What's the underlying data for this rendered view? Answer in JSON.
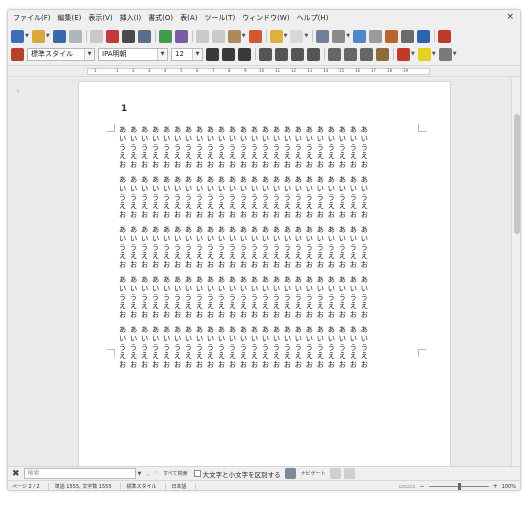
{
  "menubar": {
    "items": [
      "ファイル(F)",
      "編集(E)",
      "表示(V)",
      "挿入(I)",
      "書式(O)",
      "表(A)",
      "ツール(T)",
      "ウィンドウ(W)",
      "ヘルプ(H)"
    ],
    "close_glyph": "×"
  },
  "toolbar": {
    "paragraph_style": "標準スタイル",
    "font_name": "IPA明朝",
    "font_size": "12"
  },
  "ruler": {
    "labels": [
      "1",
      "1",
      "2",
      "3",
      "4",
      "5",
      "6",
      "7",
      "8",
      "9",
      "10",
      "11",
      "12",
      "13",
      "14",
      "15",
      "16",
      "17",
      "18",
      "19"
    ]
  },
  "document": {
    "page_number_text": "1",
    "blocks": [
      [
        "あああああああああああああああああああああああ",
        "いいいいいいいいいいいいいいいいいいいいいいい",
        "ううううううううううううううううううううううう",
        "えええええええええええええええええええええええ",
        "おおおおおおおおおおおおおおおおおおおおおおお"
      ],
      [
        "あああああああああああああああああああああああ",
        "いいいいいいいいいいいいいいいいいいいいいいい",
        "ううううううううううううううううううううううう",
        "えええええええええええええええええええええええ",
        "おおおおおおおおおおおおおおおおおおおおおおお"
      ],
      [
        "あああああああああああああああああああああああ",
        "いいいいいいいいいいいいいいいいいいいいいいい",
        "ううううううううううううううううううううううう",
        "えええええええええええええええええええええええ",
        "おおおおおおおおおおおおおおおおおおおおおおお"
      ],
      [
        "あああああああああああああああああああああああ",
        "いいいいいいいいいいいいいいいいいいいいいいい",
        "ううううううううううううううううううううううう",
        "えええええええええええええええええええええええ",
        "おおおおおおおおおおおおおおおおおおおおおおお"
      ],
      [
        "あああああああああああああああああああああああ",
        "いいいいいいいいいいいいいいいいいいいいいいい",
        "ううううううううううううううううううううううう",
        "えええええええええええええええええええええええ",
        "おおおおおおおおおおおおおおおおおおおおおおお"
      ]
    ]
  },
  "findbar": {
    "search_placeholder": "検索",
    "find_all_label": "すべて検索",
    "match_case_label": "大文字と小文字を区別する",
    "navigation_label": "ナビゲート"
  },
  "statusbar": {
    "page": "ページ 2 / 2",
    "word_count": "単語 1555, 文字数 1555",
    "page_style": "標準スタイル",
    "language": "日本語",
    "zoom": "100%"
  },
  "colors": {
    "page_bg": "#ffffff",
    "workspace_bg": "#eaeaea",
    "chrome_bg": "#efefef"
  }
}
